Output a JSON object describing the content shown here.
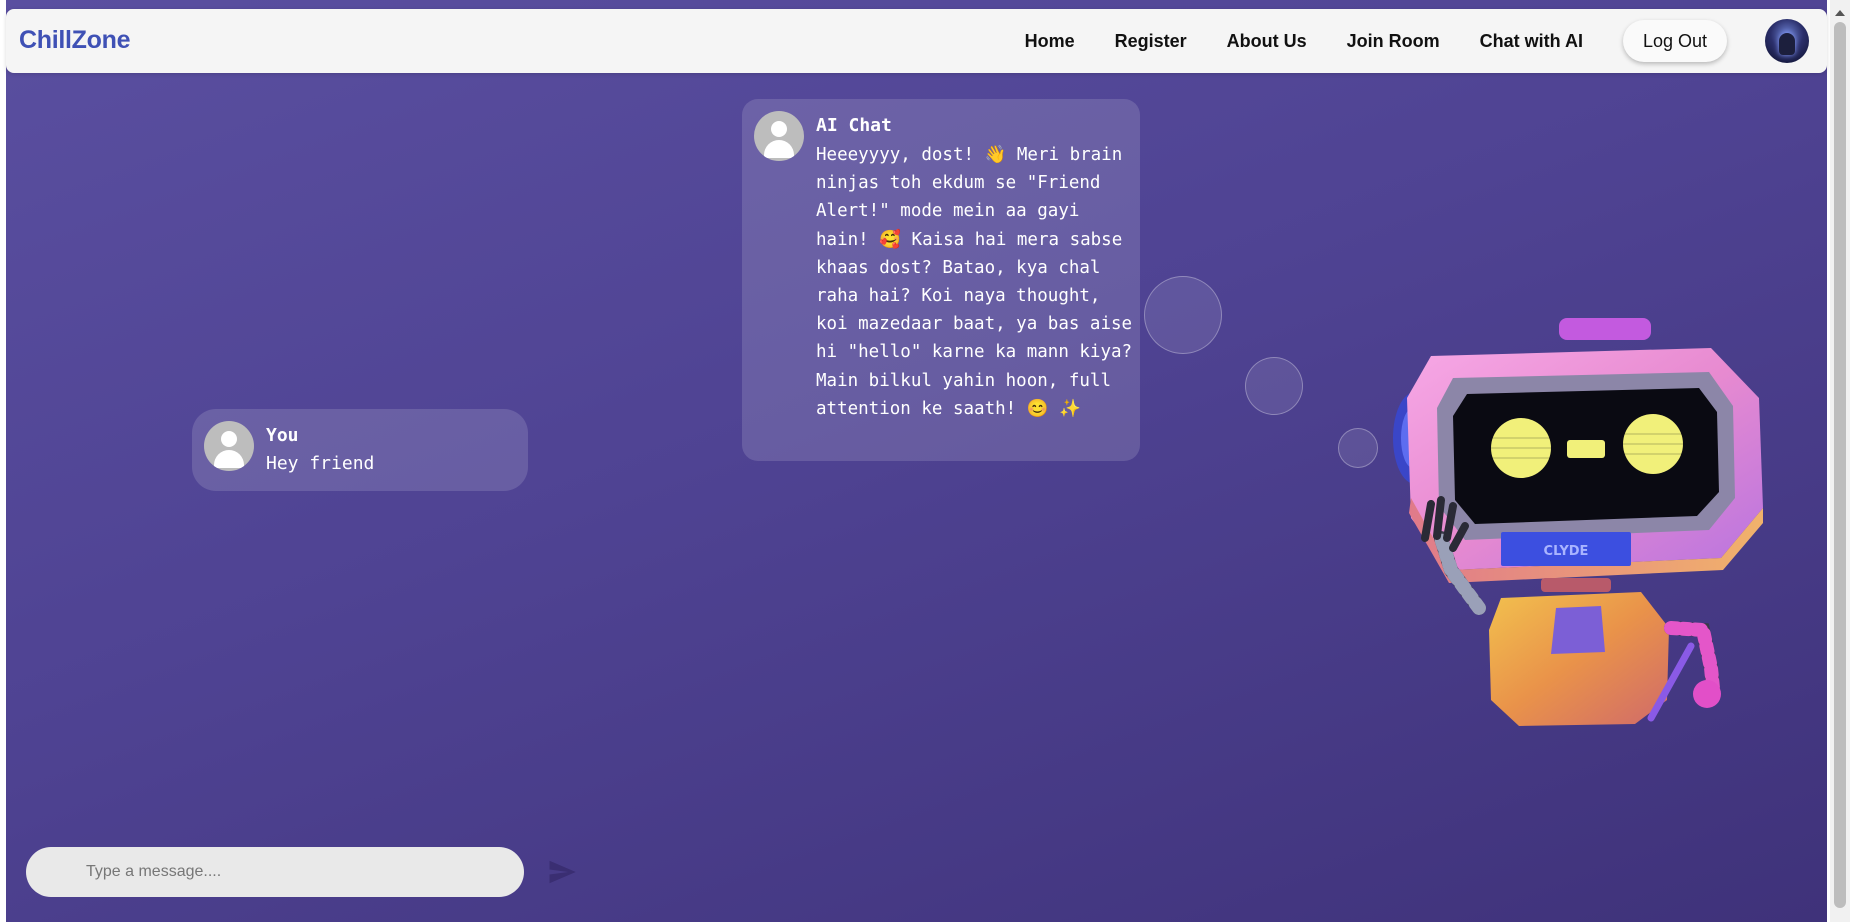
{
  "navbar": {
    "brand": "ChillZone",
    "links": [
      "Home",
      "Register",
      "About Us",
      "Join Room",
      "Chat with AI"
    ],
    "logout_label": "Log Out",
    "profile_icon": "user-avatar-icon"
  },
  "chat": {
    "user_message": {
      "sender": "You",
      "text": "Hey friend",
      "icon": "user-icon"
    },
    "ai_message": {
      "sender": "AI Chat",
      "text": "Heeeyyyy, dost! 👋 Meri brain ninjas toh ekdum se \"Friend Alert!\" mode mein aa gayi hain! 🥰 Kaisa hai mera sabse khaas dost? Batao, kya chal raha hai? Koi naya thought, koi mazedaar baat, ya bas aise hi \"hello\" karne ka mann kiya? Main bilkul yahin hoon, full attention ke saath! 😊 ✨",
      "icon": "user-icon"
    }
  },
  "robot": {
    "screen_label": "CLYDE",
    "icon": "robot-illustration"
  },
  "composer": {
    "placeholder": "Type a message....",
    "send_icon": "send-icon"
  },
  "colors": {
    "brand": "#3f51b5",
    "background_start": "#5a4fa0",
    "background_end": "#3f327a",
    "bubble": "rgba(255,255,255,0.14)"
  }
}
